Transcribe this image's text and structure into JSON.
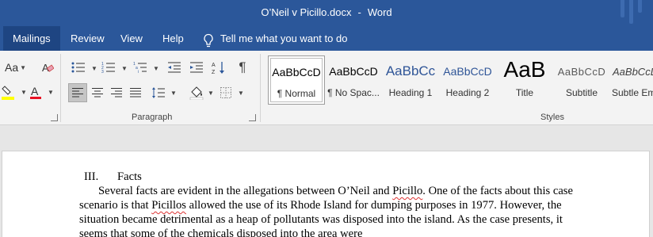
{
  "window": {
    "document_name": "O’Neil v Picillo.docx",
    "separator": "-",
    "app_name": "Word"
  },
  "tabs": [
    {
      "label": "Mailings",
      "active": true
    },
    {
      "label": "Review"
    },
    {
      "label": "View"
    },
    {
      "label": "Help"
    }
  ],
  "tell_me": {
    "label": "Tell me what you want to do"
  },
  "ribbon": {
    "font_group": {
      "change_case": "Aa"
    },
    "paragraph_group": {
      "label": "Paragraph"
    },
    "styles_group": {
      "label": "Styles",
      "items": [
        {
          "sample": "AaBbCcD",
          "name": "¶ Normal",
          "active": true
        },
        {
          "sample": "AaBbCcD",
          "name": "¶ No Spac..."
        },
        {
          "sample": "AaBbCc",
          "name": "Heading 1"
        },
        {
          "sample": "AaBbCcD",
          "name": "Heading 2"
        },
        {
          "sample": "AaB",
          "name": "Title"
        },
        {
          "sample": "AaBbCcD",
          "name": "Subtitle"
        },
        {
          "sample": "AaBbCcDd",
          "name": "Subtle Em"
        }
      ]
    },
    "colors": {
      "highlight": "#ffff00",
      "font_color": "#e81123"
    }
  },
  "document": {
    "heading_number": "III.",
    "heading_text": "Facts",
    "paragraph": {
      "p1": "Several facts are evident in the allegations between O’Neil and ",
      "w1": "Picillo",
      "p2": ". One of the facts about this case scenario is that ",
      "w2": "Picillos",
      "p3": " allowed the use of its Rhode Island for dumping purposes in 1977. However, the situation became detrimental as a heap of pollutants was disposed into the island. As the case presents, it seems that some of the chemicals disposed into the area were"
    }
  }
}
